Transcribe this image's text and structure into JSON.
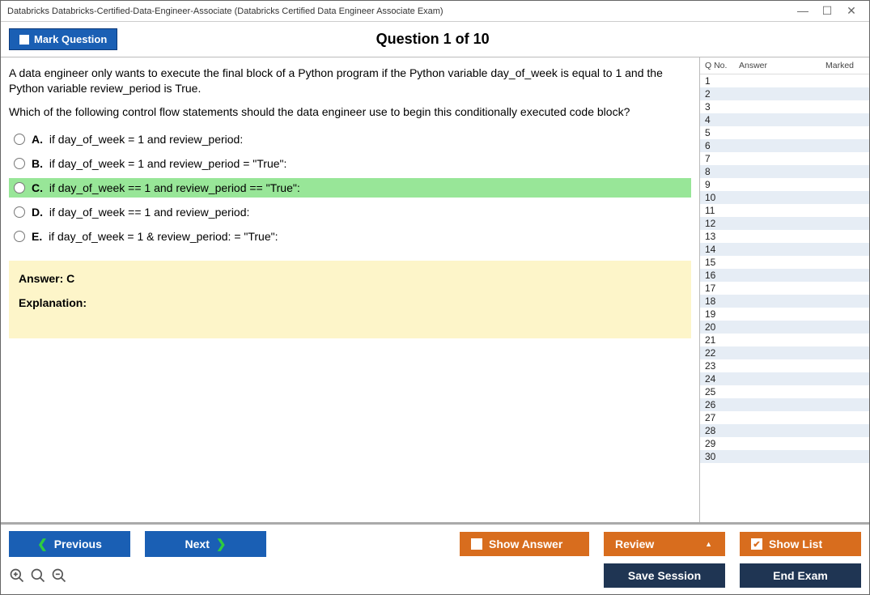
{
  "window": {
    "title": "Databricks Databricks-Certified-Data-Engineer-Associate (Databricks Certified Data Engineer Associate Exam)"
  },
  "header": {
    "mark_question_label": "Mark Question",
    "question_heading": "Question 1 of 10"
  },
  "question": {
    "text_1": "A data engineer only wants to execute the final block of a Python program if the Python variable day_of_week is equal to 1 and the Python variable review_period is True.",
    "text_2": "Which of the following control flow statements should the data engineer use to begin this conditionally executed code block?",
    "options": [
      {
        "letter": "A.",
        "text": "if day_of_week = 1 and review_period:",
        "highlight": false
      },
      {
        "letter": "B.",
        "text": "if day_of_week = 1 and review_period = \"True\":",
        "highlight": false
      },
      {
        "letter": "C.",
        "text": "if day_of_week == 1 and review_period == \"True\":",
        "highlight": true
      },
      {
        "letter": "D.",
        "text": "if day_of_week == 1 and review_period:",
        "highlight": false
      },
      {
        "letter": "E.",
        "text": "if day_of_week = 1 & review_period: = \"True\":",
        "highlight": false
      }
    ],
    "answer_line": "Answer: C",
    "explanation_label": "Explanation:"
  },
  "sidebar": {
    "col_q": "Q No.",
    "col_a": "Answer",
    "col_m": "Marked",
    "items_count": 30
  },
  "footer": {
    "previous": "Previous",
    "next": "Next",
    "show_answer": "Show Answer",
    "review": "Review",
    "show_list": "Show List",
    "save_session": "Save Session",
    "end_exam": "End Exam"
  }
}
